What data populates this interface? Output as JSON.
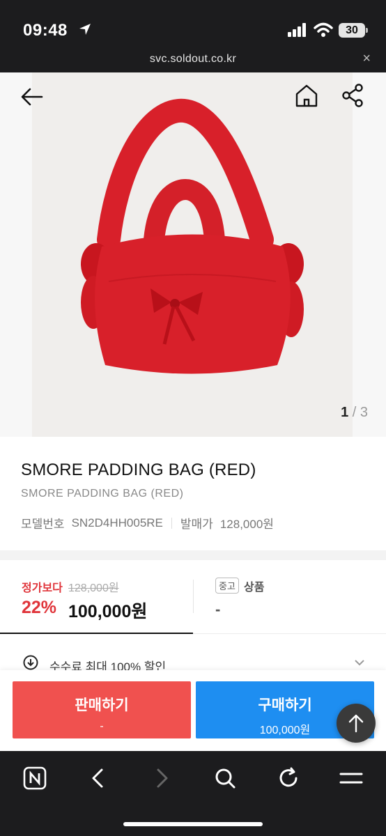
{
  "status": {
    "time": "09:48",
    "battery": "30"
  },
  "browser": {
    "url": "svc.soldout.co.kr",
    "close_glyph": "×"
  },
  "hero": {
    "current": "1",
    "separator": "/",
    "total": "3",
    "image_alt": "red padded bag"
  },
  "product": {
    "title": "SMORE PADDING BAG (RED)",
    "subtitle": "SMORE PADDING BAG (RED)",
    "model_label": "모델번호",
    "model_value": "SN2D4HH005RE",
    "release_label": "발매가",
    "release_value": "128,000원"
  },
  "pricing": {
    "orig_label": "정가보다",
    "orig_price": "128,000원",
    "discount": "22%",
    "price": "100,000원",
    "used_badge": "중고",
    "used_label": "상품",
    "used_price": "-"
  },
  "fee": {
    "text": "수수료 최대 100% 할인"
  },
  "actions": {
    "sell_label": "판매하기",
    "sell_sub": "-",
    "buy_label": "구매하기",
    "buy_sub": "100,000원"
  },
  "colors": {
    "sell": "#f0514f",
    "buy": "#1e8ef1",
    "accent_red": "#e0353b",
    "bag": "#d8202a"
  },
  "icons": [
    "location-arrow-icon",
    "signal-icon",
    "wifi-icon",
    "back-arrow-icon",
    "home-icon",
    "share-icon",
    "download-circle-icon",
    "chevron-down-icon",
    "arrow-up-icon",
    "naver-icon",
    "chevron-left-icon",
    "chevron-right-icon",
    "search-icon",
    "refresh-icon",
    "menu-icon"
  ]
}
